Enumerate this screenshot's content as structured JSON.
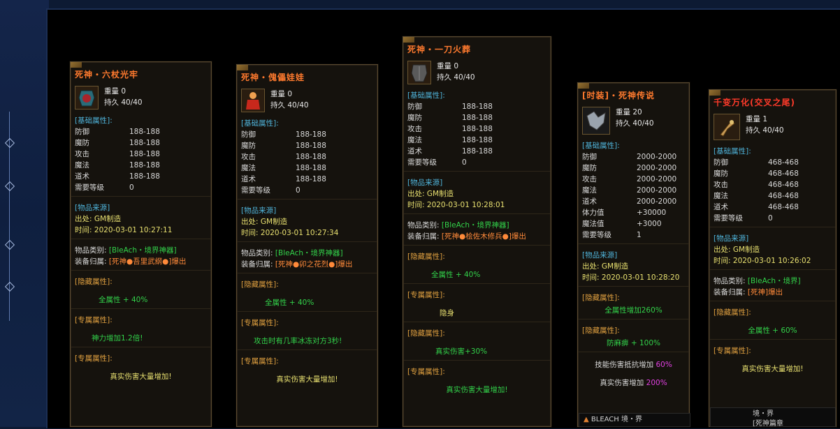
{
  "common": {
    "weight_label": "重量",
    "dura_label": "持久",
    "base_section": "[基础属性]:",
    "attr_labels": [
      "防御",
      "魔防",
      "攻击",
      "魔法",
      "道术",
      "需要等级"
    ],
    "source_section": "[物品来源]",
    "origin_label": "出处:",
    "time_label": "时间:",
    "category_label": "物品类别:",
    "belong_label": "装备归属:",
    "hidden_section": "[隐藏属性]:",
    "exclusive_section": "[专属属性]:"
  },
  "items": [
    {
      "title": "死神・六杖光牢",
      "weight": "0",
      "dura": "40/40",
      "attrs": [
        "188-188",
        "188-188",
        "188-188",
        "188-188",
        "188-188",
        "0"
      ],
      "origin": "GM制造",
      "time": "2020-03-01 10:27:11",
      "category": "[BleAch・境界神器]",
      "belong": "[死神●吾里武纲●]爆出",
      "hidden": "全属性 + 40%",
      "exclusive1": "神力增加1.2倍!",
      "exclusive2": "真实伤害大量增加!"
    },
    {
      "title": "死神・傀儡娃娃",
      "weight": "0",
      "dura": "40/40",
      "attrs": [
        "188-188",
        "188-188",
        "188-188",
        "188-188",
        "188-188",
        "0"
      ],
      "origin": "GM制造",
      "time": "2020-03-01 10:27:34",
      "category": "[BleAch・境界神器]",
      "belong": "[死神●卯之花烈●]爆出",
      "hidden": "全属性 + 40%",
      "exclusive1": "攻击时有几率冰冻对方3秒!",
      "exclusive2": "真实伤害大量增加!"
    },
    {
      "title": "死神・一刀火葬",
      "weight": "0",
      "dura": "40/40",
      "attrs": [
        "188-188",
        "188-188",
        "188-188",
        "188-188",
        "188-188",
        "0"
      ],
      "origin": "GM制造",
      "time": "2020-03-01 10:28:01",
      "category": "[BleAch・境界神器]",
      "belong": "[死神●桧佐木修兵●]爆出",
      "hidden": "全属性 + 40%",
      "exclusive1": "隐身",
      "hidden2": "真实伤害+30%",
      "exclusive2": "真实伤害大量增加!"
    },
    {
      "title": "[时装]・死神传说",
      "weight": "20",
      "dura": "40/40",
      "attr_labels": [
        "防御",
        "魔防",
        "攻击",
        "魔法",
        "道术",
        "体力值",
        "魔法值",
        "需要等级"
      ],
      "attrs": [
        "2000-2000",
        "2000-2000",
        "2000-2000",
        "2000-2000",
        "2000-2000",
        "+30000",
        "+3000",
        "1"
      ],
      "origin": "GM制造",
      "time": "2020-03-01 10:28:20",
      "hidden_title": "[隐藏属性]:",
      "hidden": "全属性增加260%",
      "hidden2_title": "[隐藏属性]:",
      "hidden2": "防麻痹 + 100%",
      "skill_label": "技能伤害抵抗增加",
      "skill_value": "60%",
      "real_label": "真实伤害增加",
      "real_value": "200%"
    },
    {
      "title": "千变万化(交叉之尾)",
      "weight": "1",
      "dura": "40/40",
      "attrs": [
        "468-468",
        "468-468",
        "468-468",
        "468-468",
        "468-468",
        "0"
      ],
      "origin": "GM制造",
      "time": "2020-03-01 10:26:02",
      "category": "[BleAch・境界]",
      "belong": "[死神]爆出",
      "hidden": "全属性 + 60%",
      "exclusive1": "真实伤害大量增加!"
    }
  ],
  "footer": {
    "popup1": "BLEACH 境・界",
    "popup2a": "境・界",
    "popup2b": "[死神篇章"
  }
}
